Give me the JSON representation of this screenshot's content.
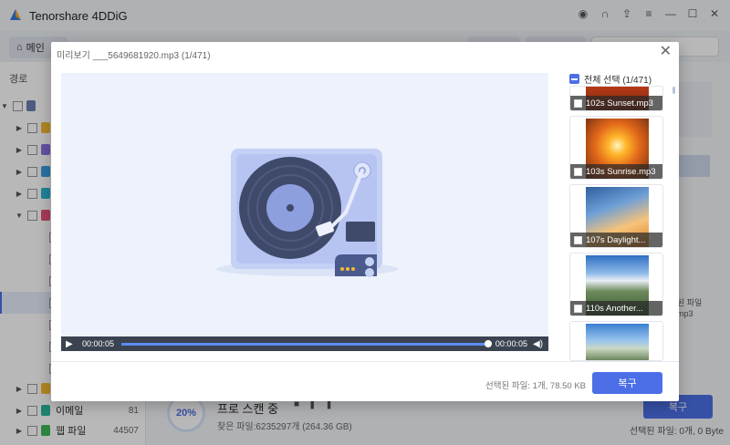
{
  "app": {
    "title": "Tenorshare 4DDiG",
    "home_tab": "메인"
  },
  "sidebar": {
    "tab_label": "경로",
    "items": [
      {
        "label": "이메일",
        "count": "81"
      },
      {
        "label": "웹 파일",
        "count": "44507"
      }
    ]
  },
  "scan": {
    "progress": "20%",
    "title": "프로 스캔 중",
    "found": "찾은 파일:6235297개 (264.36 GB)",
    "recover_label": "복구",
    "selected_info": "선택된 파일: 0개, 0 Byte",
    "right_text_1": "된 파일",
    "right_text_2": "mp3"
  },
  "preview": {
    "title": "미리보기 ___5649681920.mp3 (1/471)",
    "time_current": "00:00:05",
    "time_total": "00:00:05",
    "progress_fraction": 1.0,
    "select_all_label": "전체 선택 (1/471)",
    "thumbnails": [
      {
        "label": "102s Sunset.mp3"
      },
      {
        "label": "103s Sunrise.mp3"
      },
      {
        "label": "107s Daylight..."
      },
      {
        "label": "110s Another..."
      },
      {
        "label": ""
      }
    ],
    "selected_info": "선택된 파일: 1개, 78.50 KB",
    "recover_label": "복구"
  },
  "colors": {
    "accent": "#4c6fe7",
    "player_bar": "#3b4350",
    "preview_bg": "#edf2fc"
  }
}
